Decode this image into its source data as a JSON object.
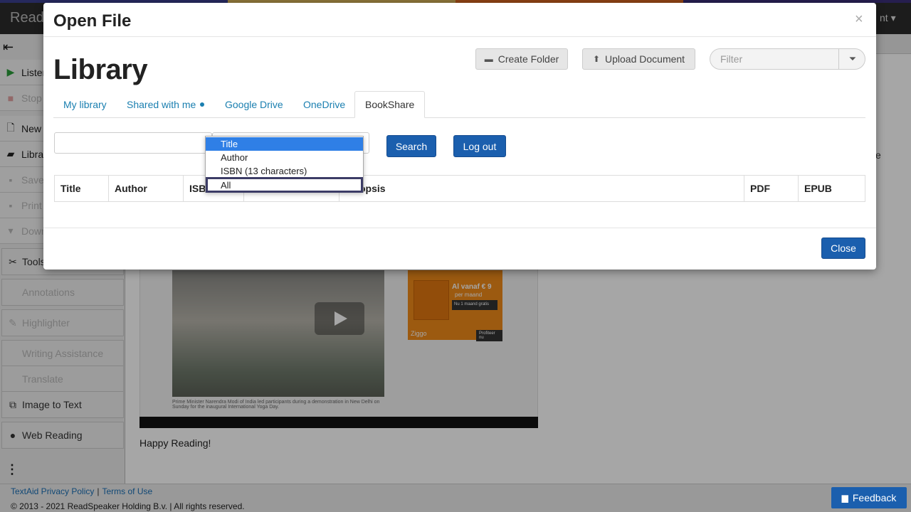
{
  "app": {
    "title": "Read",
    "user_menu": "nt ▾",
    "stripe_colors": [
      "#3b3f8f",
      "#d8b45a",
      "#d9661e",
      "#3b2f7a"
    ]
  },
  "sidebar": {
    "collapse_icon": "collapse-left-icon",
    "items": [
      {
        "label": "Listen",
        "icon": "play-icon",
        "disabled": false
      },
      {
        "label": "Stop",
        "icon": "stop-icon",
        "disabled": true
      },
      {
        "label": "New T",
        "icon": "new-document-icon",
        "disabled": false
      },
      {
        "label": "Librar",
        "icon": "folder-icon",
        "disabled": false
      },
      {
        "label": "Save",
        "icon": "save-icon",
        "disabled": true
      },
      {
        "label": "Print",
        "icon": "print-icon",
        "disabled": true
      },
      {
        "label": "Down",
        "icon": "download-icon",
        "disabled": true
      }
    ],
    "groups": [
      {
        "label": "Tools",
        "icon": "tools-icon",
        "disabled": false
      },
      {
        "label": "Annotations",
        "icon": "annotation-icon",
        "disabled": true
      },
      {
        "label": "Highlighter",
        "icon": "highlighter-icon",
        "disabled": true
      },
      {
        "label": "Writing Assistance",
        "icon": "writing-icon",
        "disabled": true
      },
      {
        "label": "Translate",
        "icon": "translate-icon",
        "disabled": true
      },
      {
        "label": "Image to Text",
        "icon": "image-text-icon",
        "disabled": false
      },
      {
        "label": "Web Reading",
        "icon": "globe-icon",
        "disabled": false
      }
    ]
  },
  "content": {
    "happy": "Happy Reading!",
    "edge_text": "e",
    "ad": {
      "title": "Al vanaf € 9",
      "sub": "per maand",
      "box": "Nu 1 maand gratis",
      "logo": "Ziggo",
      "button": "Profiteer nu"
    },
    "caption": "Prime Minister Narendra Modi of India led participants during a demonstration in New Delhi on Sunday for the inaugural International Yoga Day."
  },
  "footer": {
    "privacy": "TextAid Privacy Policy",
    "terms": "Terms of Use",
    "copyright": "© 2013 - 2021 ReadSpeaker Holding B.v. | All rights reserved.",
    "feedback": "Feedback"
  },
  "modal": {
    "title": "Open File",
    "close_x": "×",
    "library_heading": "Library",
    "create_folder": "Create Folder",
    "upload_document": "Upload Document",
    "filter_placeholder": "Filter",
    "tabs": [
      {
        "label": "My library",
        "active": false
      },
      {
        "label": "Shared with me",
        "active": false
      },
      {
        "label": "Google Drive",
        "active": false
      },
      {
        "label": "OneDrive",
        "active": false
      },
      {
        "label": "BookShare",
        "active": true
      }
    ],
    "search_button": "Search",
    "logout_button": "Log out",
    "select_options": [
      "Title",
      "Author",
      "ISBN (13 characters)",
      "All"
    ],
    "selected_option": "Title",
    "focused_option": "All",
    "columns": [
      "Title",
      "Author",
      "ISB",
      "",
      "opsis",
      "PDF",
      "EPUB"
    ],
    "close_button": "Close"
  }
}
